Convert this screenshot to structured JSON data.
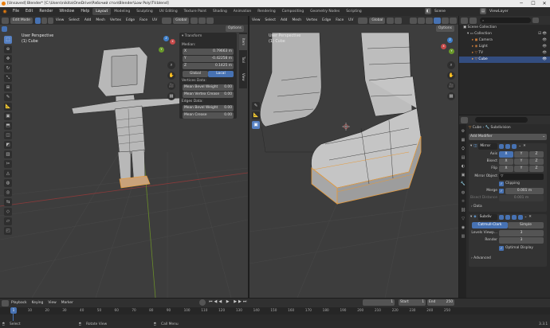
{
  "window": {
    "title": "[Unsaved] Blender* [C:\\Users\\nikita\\OneDrive\\Рабочий стол\\Blender\\Low Poly\\TV.blend]",
    "minimize": "─",
    "maximize": "☐",
    "close": "✕"
  },
  "menus": [
    "File",
    "Edit",
    "Render",
    "Window",
    "Help"
  ],
  "workspaces": [
    "Layout",
    "Modeling",
    "Sculpting",
    "UV Editing",
    "Texture Paint",
    "Shading",
    "Animation",
    "Rendering",
    "Compositing",
    "Geometry Nodes",
    "Scripting"
  ],
  "active_workspace": "Layout",
  "scene": {
    "label": "Scene",
    "viewlayer": "ViewLayer"
  },
  "left_header": {
    "mode": "Edit Mode",
    "menus": [
      "View",
      "Select",
      "Add",
      "Mesh",
      "Vertex",
      "Edge",
      "Face",
      "UV"
    ],
    "orientation": "Global",
    "options": "Options"
  },
  "left_viewport": {
    "title": "User Perspective",
    "subtitle": "(1) Cube"
  },
  "right_header": {
    "menus": [
      "View",
      "Select",
      "Add",
      "Mesh",
      "Vertex",
      "Edge",
      "Face",
      "UV"
    ],
    "orientation": "Global",
    "options": "Options"
  },
  "right_viewport": {
    "title": "User Perspective",
    "subtitle": "(1) Cube"
  },
  "npanel": {
    "section": "Transform",
    "median": "Median:",
    "x_label": "X",
    "x_value": "0.79663 m",
    "y_label": "Y",
    "y_value": "-0.42258 m",
    "z_label": "Z",
    "z_value": "0.1425 m",
    "global": "Global",
    "local": "Local",
    "vertices_data": "Vertices Data:",
    "mean_bevel_weight": "Mean Bevel Weight",
    "mbw_value": "0.00",
    "mean_vertex_crease": "Mean Vertex Crease",
    "mvc_value": "0.00",
    "edges_data": "Edges Data:",
    "edge_bevel": "Mean Bevel Weight",
    "eb_value": "0.00",
    "mean_crease": "Mean Crease",
    "mc_value": "0.00"
  },
  "npanel_tabs": [
    "Item",
    "Tool",
    "View"
  ],
  "outliner": {
    "search_placeholder": "",
    "items": [
      {
        "label": "Scene Collection",
        "icon": "collection-icon"
      },
      {
        "label": "Collection",
        "icon": "collection-icon"
      },
      {
        "label": "Camera",
        "icon": "camera-icon"
      },
      {
        "label": "Light",
        "icon": "light-icon"
      },
      {
        "label": "TV",
        "icon": "object-icon"
      },
      {
        "label": "Cube",
        "icon": "mesh-icon"
      }
    ]
  },
  "properties": {
    "object_name": "Cube",
    "modifier_name": "Subdivision",
    "add_modifier": "Add Modifier",
    "mirror": {
      "name": "Mirror",
      "axis": "Axis",
      "bisect": "Bisect",
      "flip": "Flip",
      "x": "X",
      "y": "Y",
      "z": "Z",
      "mirror_object": "Mirror Object",
      "clipping": "Clipping",
      "merge": "Merge",
      "merge_value": "0.001 m",
      "bisect_distance": "Bisect Distance",
      "bisect_distance_value": "0.001 m",
      "data": "Data"
    },
    "subdiv": {
      "name": "Subdiv",
      "catmull": "Catmull-Clark",
      "simple": "Simple",
      "levels_viewport": "Levels Viewp...",
      "levels_value": "3",
      "render": "Render",
      "render_value": "3",
      "optimal_display": "Optimal Display",
      "advanced": "Advanced"
    }
  },
  "timeline": {
    "menus": [
      "Playback",
      "Keying",
      "View",
      "Marker"
    ],
    "frame": "1",
    "start_label": "Start",
    "start": "1",
    "end_label": "End",
    "end": "250",
    "ticks": [
      "0",
      "10",
      "20",
      "30",
      "40",
      "50",
      "60",
      "70",
      "80",
      "90",
      "100",
      "110",
      "120",
      "130",
      "140",
      "150",
      "160",
      "170",
      "180",
      "190",
      "200",
      "210",
      "220",
      "230",
      "240",
      "250"
    ]
  },
  "statusbar": {
    "select": "Select",
    "rotate": "Rotate View",
    "call_menu": "Call Menu",
    "version": "3.3.1"
  },
  "colors": {
    "accent": "#4772b3",
    "selected": "#334d80",
    "viewport": "#3d3d3d",
    "orange": "#e69a3a"
  }
}
